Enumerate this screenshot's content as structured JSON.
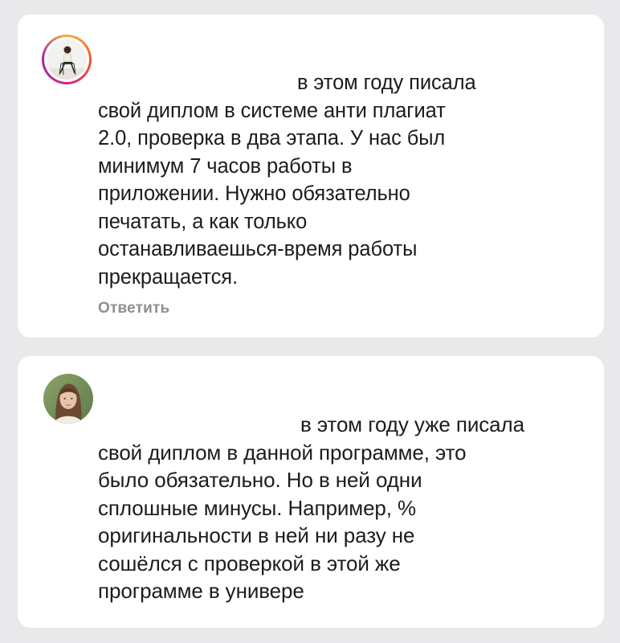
{
  "comments": [
    {
      "avatar_icon": "avatar-woman-sitting-on-chair",
      "has_story_ring": true,
      "text": "в этом году писала\nсвой диплом в системе анти плагиат\n2.0, проверка в два этапа. У нас был\nминимум 7 часов работы в\nприложении. Нужно обязательно\nпечатать, а как только\nостанавливаешься-время работы\nпрекращается.",
      "reply_label": "Ответить"
    },
    {
      "avatar_icon": "avatar-woman-portrait",
      "has_story_ring": false,
      "text": "в этом году уже писала\nсвой диплом в данной программе, это\nбыло обязательно. Но в ней одни\nсплошные минусы. Например, %\nоригинальности в ней ни разу не\nсошёлся с проверкой в этой же\nпрограмме в универе"
    }
  ],
  "colors": {
    "background": "#e9e9ec",
    "card": "#ffffff",
    "text": "#1c1c1e",
    "reply": "#8e8e93"
  }
}
